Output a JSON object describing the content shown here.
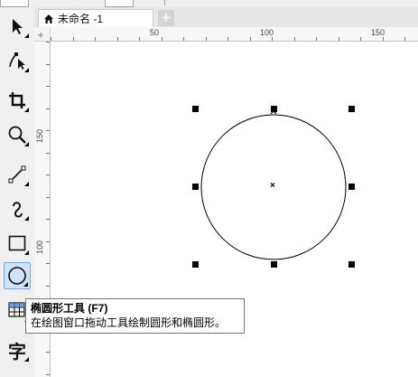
{
  "document": {
    "tab_label": "未命名 -1",
    "add_tab_symbol": "+"
  },
  "rulers": {
    "horizontal_labels": [
      "50",
      "100",
      "150"
    ],
    "vertical_labels": [
      "150",
      "100"
    ]
  },
  "toolbox": {
    "tools": [
      {
        "name": "pick-tool",
        "icon": "arrow-pointer-icon"
      },
      {
        "name": "shape-tool",
        "icon": "shape-node-icon"
      },
      {
        "name": "crop-tool",
        "icon": "crop-icon"
      },
      {
        "name": "zoom-tool",
        "icon": "magnifier-icon"
      },
      {
        "name": "line-tool",
        "icon": "line-icon"
      },
      {
        "name": "artistic-media-tool",
        "icon": "artistic-curve-icon"
      },
      {
        "name": "rectangle-tool",
        "icon": "rectangle-icon"
      },
      {
        "name": "ellipse-tool",
        "icon": "ellipse-icon",
        "active": true
      },
      {
        "name": "table-tool",
        "icon": "table-grid-icon"
      },
      {
        "name": "text-tool",
        "icon": "text-char-icon",
        "glyph": "字"
      }
    ]
  },
  "tooltip": {
    "title": "椭圆形工具 (F7)",
    "description": "在绘图窗口拖动工具绘制圆形和椭圆形。"
  },
  "canvas": {
    "shape": "circle",
    "center_symbol": "×"
  },
  "colors": {
    "accent_selected": "#cfe3fb",
    "canvas": "#ffffff",
    "chrome": "#f0f0f0"
  }
}
